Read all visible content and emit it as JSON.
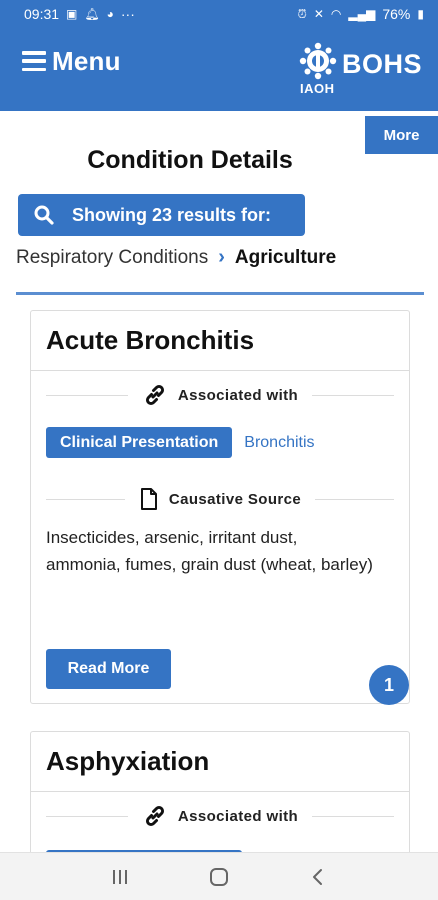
{
  "status_bar": {
    "time": "09:31",
    "battery": "76%",
    "more_dots": "···"
  },
  "header": {
    "menu_label": "Menu",
    "logo_name": "BOHS",
    "logo_sub": "IAOH"
  },
  "more_label": "More",
  "page_title": "Condition Details",
  "results_label": "Showing 23 results for:",
  "breadcrumb": {
    "parent": "Respiratory Conditions",
    "current": "Agriculture"
  },
  "cards": [
    {
      "title": "Acute Bronchitis",
      "associated_heading": "Associated with",
      "tag_primary": "Clinical Presentation",
      "tag_link": "Bronchitis",
      "source_heading": "Causative Source",
      "source_text": "Insecticides, arsenic, irritant dust, ammonia, fumes, grain dust (wheat, barley)",
      "read_more": "Read More",
      "badge": "1"
    },
    {
      "title": "Asphyxiation",
      "associated_heading": "Associated with"
    }
  ],
  "colors": {
    "primary": "#3574c4",
    "text": "#222222",
    "border": "#dcdcdc"
  }
}
